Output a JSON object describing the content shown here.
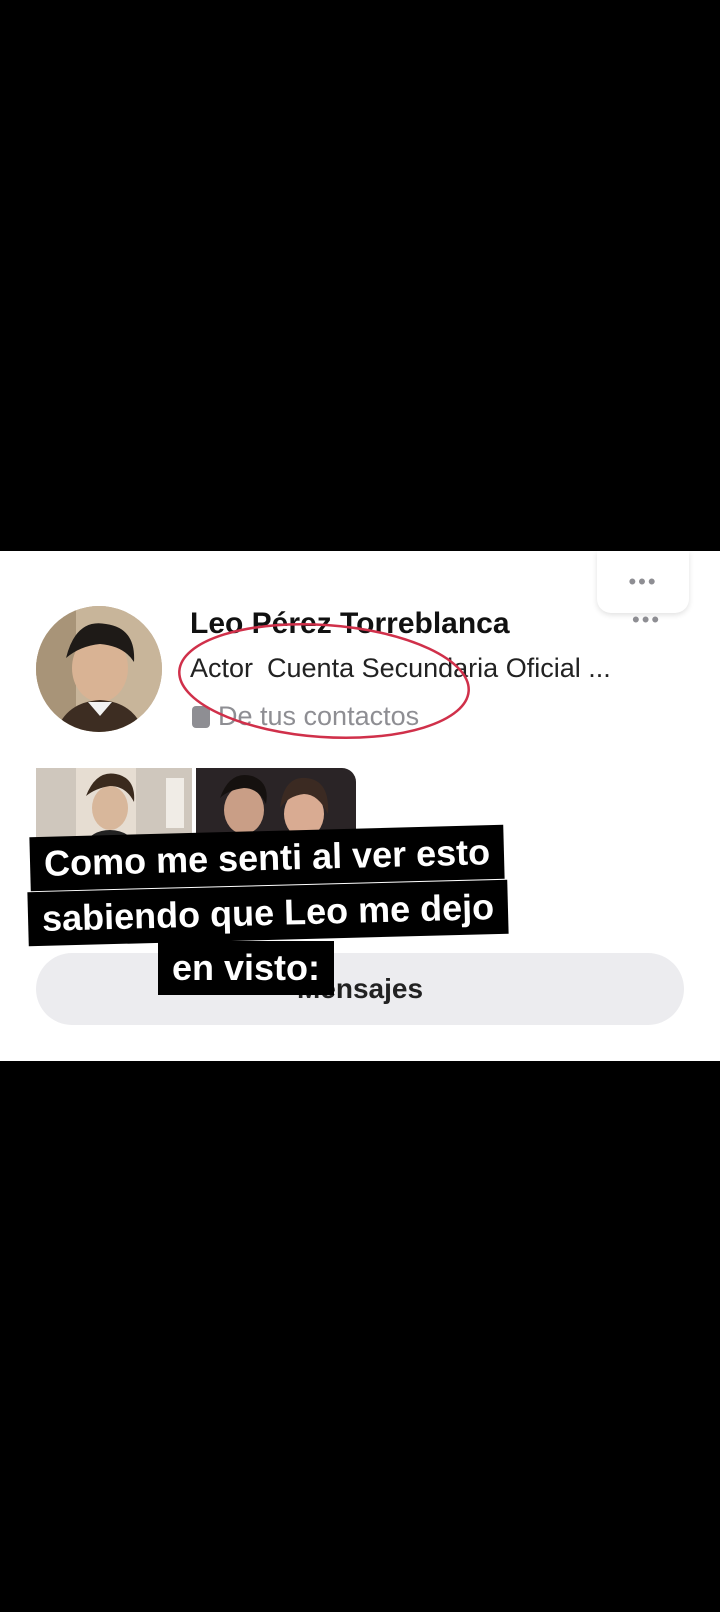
{
  "profile": {
    "name": "Leo Pérez Torreblanca",
    "subtitle_role": "Actor",
    "subtitle_account": "Cuenta Secundaria Oficial",
    "subtitle_more": "...",
    "contacts_label": "De tus contactos"
  },
  "header": {
    "more_glyph": "•••"
  },
  "card": {
    "more_glyph": "•••"
  },
  "actions": {
    "messages_label": "Mensajes"
  },
  "overlay_caption": {
    "line1": "Como me senti al ver esto",
    "line2": "sabiendo que Leo me dejo",
    "line3": "en visto:"
  },
  "colors": {
    "annotation_circle": "#d0304a",
    "secondary_text": "#8e8e93"
  }
}
